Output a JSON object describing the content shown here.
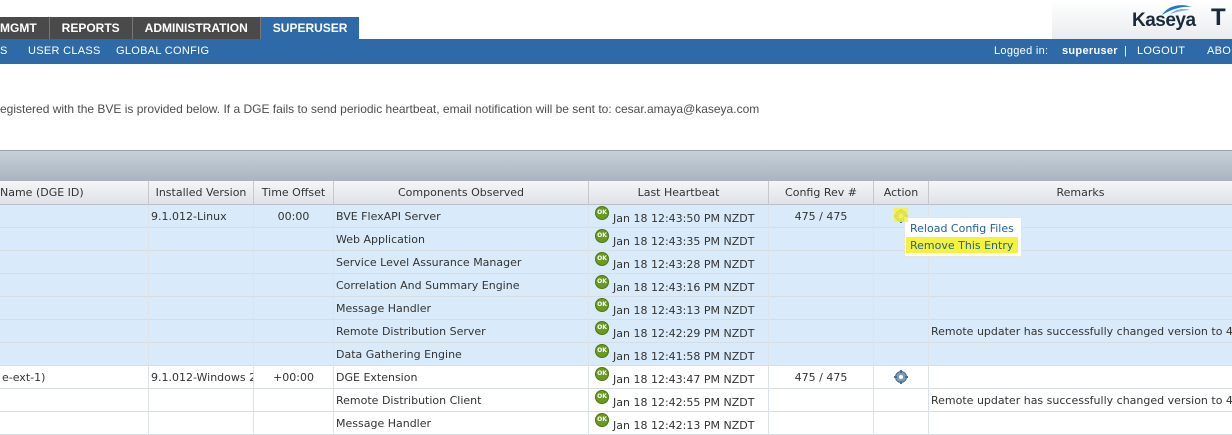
{
  "tabs": [
    {
      "label": "MGMT",
      "active": false
    },
    {
      "label": "REPORTS",
      "active": false
    },
    {
      "label": "ADMINISTRATION",
      "active": false
    },
    {
      "label": "SUPERUSER",
      "active": true
    }
  ],
  "brand": {
    "name": "Kaseya",
    "cut_letter": "T"
  },
  "subnav": {
    "items": [
      "S",
      "USER CLASS",
      "GLOBAL CONFIG"
    ],
    "logged_in_label": "Logged in:",
    "user": "superuser",
    "separator": "|",
    "logout": "LOGOUT",
    "about": "ABOU"
  },
  "message": "egistered with the BVE is provided below. If a DGE fails to send periodic heartbeat, email notification will be sent to: cesar.amaya@kaseya.com",
  "columns": [
    "Name (DGE ID)",
    "Installed Version",
    "Time Offset",
    "Components Observed",
    "Last Heartbeat",
    "Config Rev #",
    "Action",
    "Remarks"
  ],
  "ok_label": "OK",
  "rows": [
    {
      "name": "",
      "version": "9.1.012-Linux",
      "offset": "00:00",
      "component": "BVE FlexAPI Server",
      "heartbeat": "Jan 18 12:43:50 PM NZDT",
      "rev": "475 / 475",
      "action": true,
      "remarks": "",
      "selected": true
    },
    {
      "name": "",
      "version": "",
      "offset": "",
      "component": "Web Application",
      "heartbeat": "Jan 18 12:43:35 PM NZDT",
      "rev": "",
      "action": false,
      "remarks": "",
      "selected": true
    },
    {
      "name": "",
      "version": "",
      "offset": "",
      "component": "Service Level Assurance Manager",
      "heartbeat": "Jan 18 12:43:28 PM NZDT",
      "rev": "",
      "action": false,
      "remarks": "",
      "selected": true
    },
    {
      "name": "",
      "version": "",
      "offset": "",
      "component": "Correlation And Summary Engine",
      "heartbeat": "Jan 18 12:43:16 PM NZDT",
      "rev": "",
      "action": false,
      "remarks": "",
      "selected": true
    },
    {
      "name": "",
      "version": "",
      "offset": "",
      "component": "Message Handler",
      "heartbeat": "Jan 18 12:43:13 PM NZDT",
      "rev": "",
      "action": false,
      "remarks": "",
      "selected": true
    },
    {
      "name": "",
      "version": "",
      "offset": "",
      "component": "Remote Distribution Server",
      "heartbeat": "Jan 18 12:42:29 PM NZDT",
      "rev": "",
      "action": false,
      "remarks": "Remote updater has successfully changed version to 4",
      "selected": true
    },
    {
      "name": "",
      "version": "",
      "offset": "",
      "component": "Data Gathering Engine",
      "heartbeat": "Jan 18 12:41:58 PM NZDT",
      "rev": "",
      "action": false,
      "remarks": "",
      "selected": true
    },
    {
      "name": "e-ext-1)",
      "version": "9.1.012-Windows 2",
      "offset": "+00:00",
      "component": "DGE Extension",
      "heartbeat": "Jan 18 12:43:47 PM NZDT",
      "rev": "475 / 475",
      "action": true,
      "remarks": "",
      "selected": false
    },
    {
      "name": "",
      "version": "",
      "offset": "",
      "component": "Remote Distribution Client",
      "heartbeat": "Jan 18 12:42:55 PM NZDT",
      "rev": "",
      "action": false,
      "remarks": "Remote updater has successfully changed version to 4",
      "selected": false
    },
    {
      "name": "",
      "version": "",
      "offset": "",
      "component": "Message Handler",
      "heartbeat": "Jan 18 12:42:13 PM NZDT",
      "rev": "",
      "action": false,
      "remarks": "",
      "selected": false
    }
  ],
  "context_menu": {
    "reload": "Reload Config Files",
    "remove": "Remove This Entry",
    "highlight_color": "#f4f23c"
  },
  "colors": {
    "nav_blue": "#2e6aa8",
    "tab_dark": "#4a4a4a",
    "selected_row": "#d9ebfa",
    "ok_green": "#6a9a1f",
    "link_blue": "#1f5f9e"
  }
}
